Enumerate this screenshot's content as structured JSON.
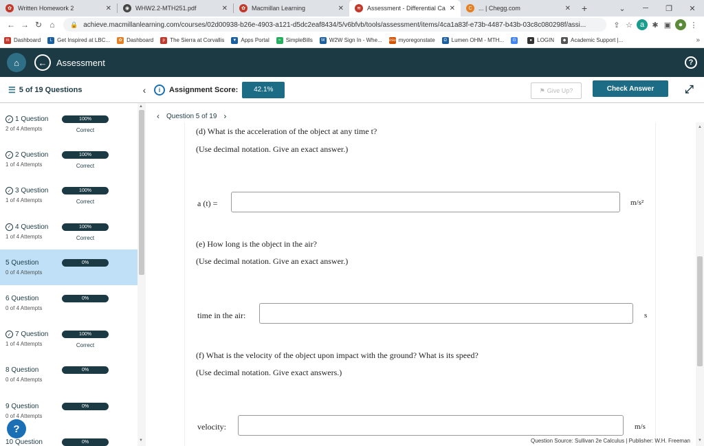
{
  "browser": {
    "tabs": [
      {
        "title": "Written Homework 2",
        "icon_color": "#c0392b",
        "icon": "✿"
      },
      {
        "title": "WHW2.2-MTH251.pdf",
        "icon_color": "#444444",
        "icon": "◉"
      },
      {
        "title": "Macmillan Learning",
        "icon_color": "#c0392b",
        "icon": "✿"
      },
      {
        "title": "Assessment - Differential Calcu",
        "icon_color": "#c0392b",
        "icon": "≋"
      },
      {
        "title": "... | Chegg.com",
        "icon_color": "#e67e22",
        "icon": "C"
      }
    ],
    "active_tab_index": 3,
    "new_tab": "+",
    "url": "achieve.macmillanlearning.com/courses/02d00938-b26e-4903-a121-d5dc2eaf8434/5/v6bfvb/tools/assessment/items/4ca1a83f-e73b-4487-b43b-03c8c080298f/assi...",
    "bookmarks": [
      {
        "label": "Dashboard",
        "icon_color": "#c0392b",
        "icon": "m"
      },
      {
        "label": "Get Inspired at LBC...",
        "icon_color": "#1a5fa0",
        "icon": "L"
      },
      {
        "label": "Dashboard",
        "icon_color": "#e67e22",
        "icon": "✿"
      },
      {
        "label": "The Sierra at Corvallis",
        "icon_color": "#c0392b",
        "icon": "p"
      },
      {
        "label": "Apps Portal",
        "icon_color": "#1a5fa0",
        "icon": "▼"
      },
      {
        "label": "SimpleBills",
        "icon_color": "#27ae60",
        "icon": "≈"
      },
      {
        "label": "W2W Sign In - Whe...",
        "icon_color": "#1a5fa0",
        "icon": "W"
      },
      {
        "label": "myoregonstate",
        "icon_color": "#d35400",
        "icon": "osu"
      },
      {
        "label": "Lumen OHM - MTH...",
        "icon_color": "#1a5fa0",
        "icon": "Ω"
      },
      {
        "label": "",
        "icon_color": "#4285f4",
        "icon": "G"
      },
      {
        "label": "LOGIN",
        "icon_color": "#333333",
        "icon": "●"
      },
      {
        "label": "Academic Support |...",
        "icon_color": "#555555",
        "icon": "◆"
      }
    ],
    "bookmarks_more": "»"
  },
  "header": {
    "title": "Assessment",
    "help": "?"
  },
  "toolbar": {
    "question_count": "5 of 19 Questions",
    "score_label": "Assignment Score:",
    "score_value": "42.1%",
    "give_up_label": "Give Up?",
    "check_answer_label": "Check Answer"
  },
  "sidebar": {
    "questions": [
      {
        "name": "1 Question",
        "attempts": "2 of 4 Attempts",
        "progress": "100%",
        "status": "Correct",
        "checked": true
      },
      {
        "name": "2 Question",
        "attempts": "1 of 4 Attempts",
        "progress": "100%",
        "status": "Correct",
        "checked": true
      },
      {
        "name": "3 Question",
        "attempts": "1 of 4 Attempts",
        "progress": "100%",
        "status": "Correct",
        "checked": true
      },
      {
        "name": "4 Question",
        "attempts": "1 of 4 Attempts",
        "progress": "100%",
        "status": "Correct",
        "checked": true
      },
      {
        "name": "5 Question",
        "attempts": "0 of 4 Attempts",
        "progress": "0%",
        "status": "",
        "checked": false
      },
      {
        "name": "6 Question",
        "attempts": "0 of 4 Attempts",
        "progress": "0%",
        "status": "",
        "checked": false
      },
      {
        "name": "7 Question",
        "attempts": "1 of 4 Attempts",
        "progress": "100%",
        "status": "Correct",
        "checked": true
      },
      {
        "name": "8 Question",
        "attempts": "0 of 4 Attempts",
        "progress": "0%",
        "status": "",
        "checked": false
      },
      {
        "name": "9 Question",
        "attempts": "0 of 4 Attempts",
        "progress": "0%",
        "status": "",
        "checked": false
      },
      {
        "name": "10 Question",
        "attempts": "",
        "progress": "0%",
        "status": "",
        "checked": false
      }
    ],
    "active_index": 4,
    "help_button": "?"
  },
  "main": {
    "question_nav": "Question 5 of 19",
    "part_d_prompt": "(d) What is the acceleration of the object at any time t?",
    "part_d_note": "(Use decimal notation. Give an exact answer.)",
    "part_d_label": "a (t) =",
    "part_d_value": "",
    "part_d_unit": "m/s²",
    "part_e_prompt": "(e) How long is the object in the air?",
    "part_e_note": "(Use decimal notation. Give an exact answer.)",
    "part_e_label": "time in the air:",
    "part_e_value": "",
    "part_e_unit": "s",
    "part_f_prompt": "(f) What is the velocity of the object upon impact with the ground? What is its speed?",
    "part_f_note": "(Use decimal notation. Give exact answers.)",
    "part_f_label": "velocity:",
    "part_f_value": "",
    "part_f_unit": "m/s",
    "source": "Question Source: Sullivan 2e Calculus  |  Publisher: W.H. Freeman"
  }
}
